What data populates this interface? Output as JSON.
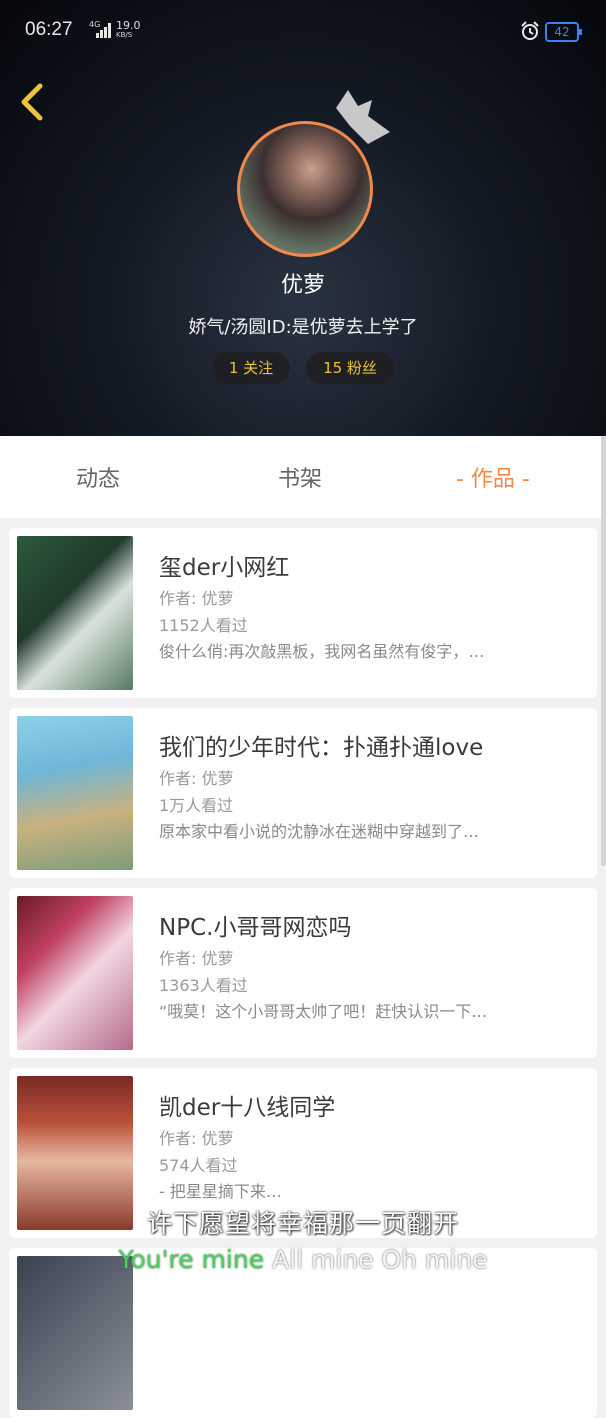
{
  "status_bar": {
    "time": "06:27",
    "network": "4G",
    "speed_value": "19.0",
    "speed_unit": "KB/S",
    "battery": "42"
  },
  "profile": {
    "name": "优萝",
    "bio": "娇气/汤圆ID:是优萝去上学了",
    "following": "1 关注",
    "fans": "15 粉丝"
  },
  "tabs": [
    "动态",
    "书架",
    "- 作品 -"
  ],
  "active_tab": 2,
  "works": [
    {
      "title": "玺der小网红",
      "author": "作者: 优萝",
      "views": "1152人看过",
      "desc": "俊什么俏:再次敲黑板，我网名虽然有俊字，…"
    },
    {
      "title": "我们的少年时代：扑通扑通love",
      "author": "作者: 优萝",
      "views": "1万人看过",
      "desc": "原本家中看小说的沈静冰在迷糊中穿越到了…"
    },
    {
      "title": "NPC.小哥哥网恋吗",
      "author": "作者: 优萝",
      "views": "1363人看过",
      "desc": "“哦莫！这个小哥哥太帅了吧！赶快认识一下…"
    },
    {
      "title": "凯der十八线同学",
      "author": "作者: 优萝",
      "views": "574人看过",
      "desc": "- 把星星摘下来…"
    }
  ],
  "subtitle_line1": "许下愿望将幸福那一页翻开",
  "subtitle_line2_green": "You're mine",
  "subtitle_line2_white": " All mine Oh mine",
  "colors": {
    "accent": "#f08a4b",
    "fan_pill_text": "#f0c23a",
    "battery": "#3b82f6",
    "subtitle_green": "#45d35a"
  }
}
